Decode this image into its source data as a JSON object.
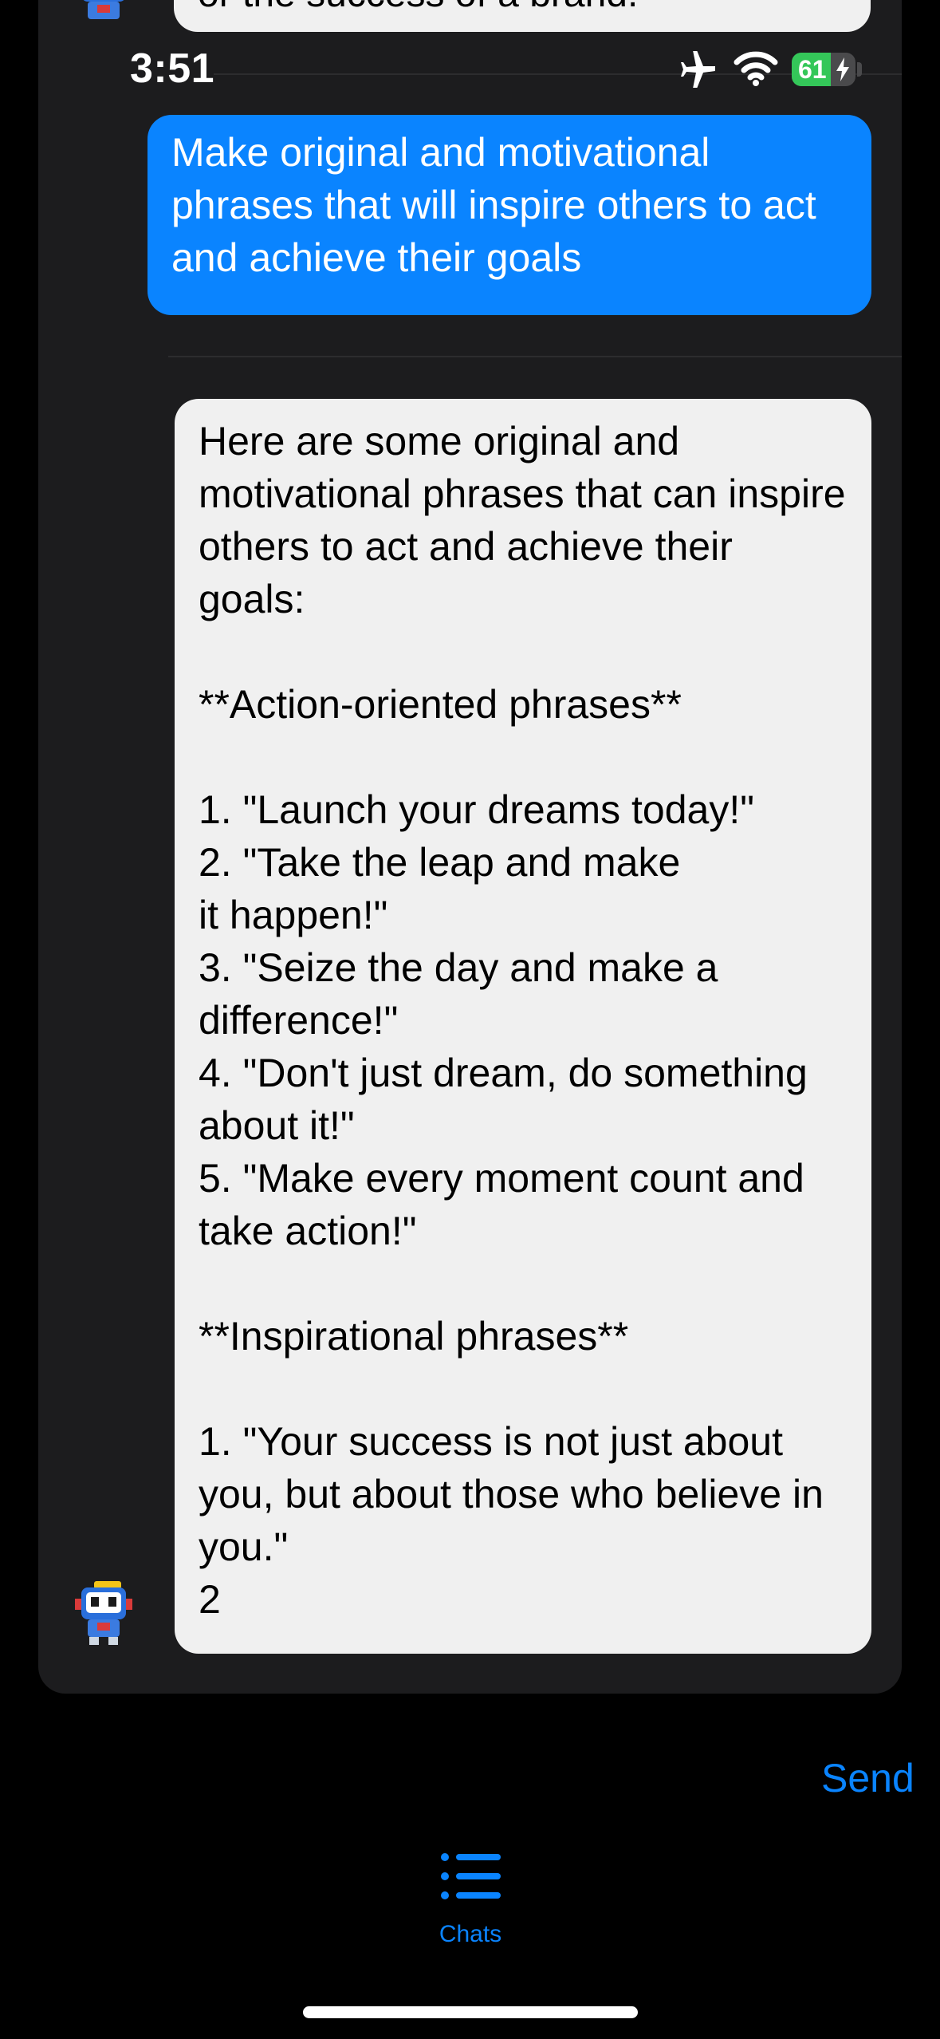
{
  "status_bar": {
    "time": "3:51",
    "battery_level": "61",
    "battery_fraction": 0.61,
    "airplane_icon": "airplane-icon",
    "wifi_icon": "wifi-icon",
    "charging_icon": "bolt-icon"
  },
  "chat": {
    "previous_bubble_text": "or the success of a brand.",
    "user_message": "Make original and motivational phrases that will inspire others to act and achieve their goals",
    "bot_message": "Here are some original and motivational phrases that can inspire others to act and achieve their goals:\n\n**Action-oriented phrases**\n\n1. \"Launch your dreams today!\"\n2. \"Take the leap and make\nit happen!\"\n3. \"Seize the day and make a difference!\"\n4. \"Don't just dream, do something about it!\"\n5. \"Make every moment count and take action!\"\n\n**Inspirational phrases**\n\n1. \"Your success is not just about you, but about those who believe in you.\"\n2"
  },
  "composer": {
    "send_label": "Send"
  },
  "tab_bar": {
    "chats_label": "Chats",
    "chats_icon": "list-icon"
  },
  "colors": {
    "accent": "#0a84ff",
    "panel": "#1c1c1e",
    "bot_bubble": "#f0f0f0",
    "battery_green": "#34c759"
  }
}
